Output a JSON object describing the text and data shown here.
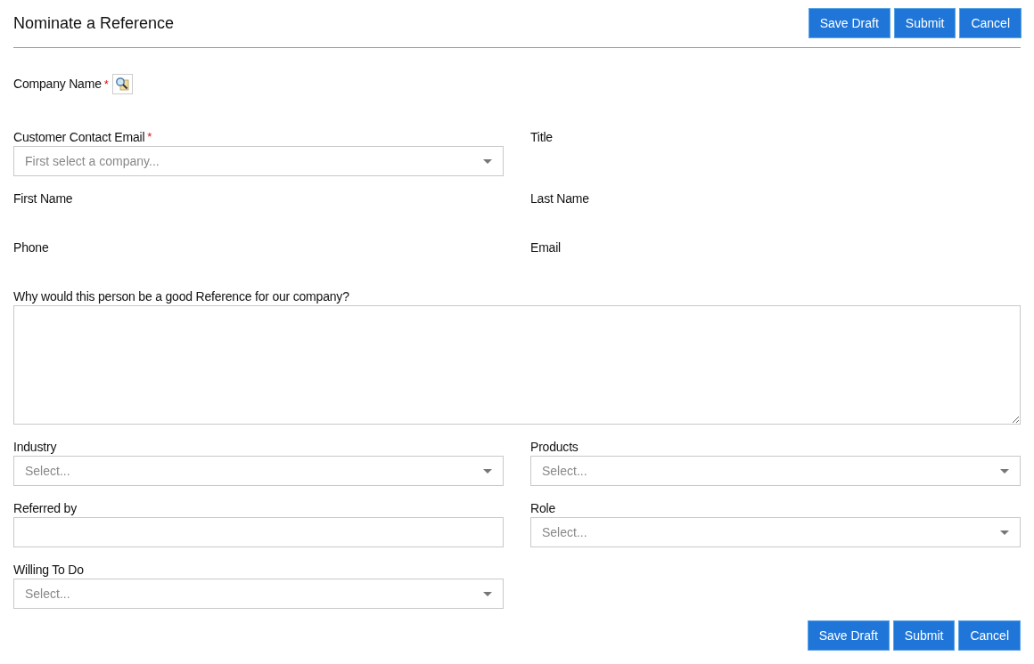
{
  "header": {
    "title": "Nominate a Reference",
    "buttons": [
      "Save Draft",
      "Submit",
      "Cancel"
    ]
  },
  "rows": [
    [
      {
        "kind": "lookup",
        "label": "Company Name",
        "marker": "*"
      }
    ],
    [
      {
        "kind": "select",
        "label": "Customer Contact Email",
        "marker": "*",
        "placeholder": "First select a company..."
      },
      {
        "kind": "readonly",
        "label": "Title"
      }
    ],
    [
      {
        "kind": "readonly",
        "label": "First Name"
      },
      {
        "kind": "readonly",
        "label": "Last Name"
      }
    ],
    [
      {
        "kind": "readonly",
        "label": "Phone"
      },
      {
        "kind": "readonly",
        "label": "Email"
      }
    ],
    [
      {
        "kind": "textarea",
        "label": "Why would this person be a good Reference for our company?"
      }
    ],
    [
      {
        "kind": "select",
        "label": "Industry",
        "placeholder": "Select..."
      },
      {
        "kind": "select",
        "label": "Products",
        "placeholder": "Select..."
      }
    ],
    [
      {
        "kind": "text",
        "label": "Referred by"
      },
      {
        "kind": "select",
        "label": "Role",
        "placeholder": "Select..."
      }
    ],
    [
      {
        "kind": "select",
        "label": "Willing To Do",
        "placeholder": "Select..."
      }
    ]
  ],
  "footer_buttons": [
    "Save Draft",
    "Submit",
    "Cancel"
  ]
}
